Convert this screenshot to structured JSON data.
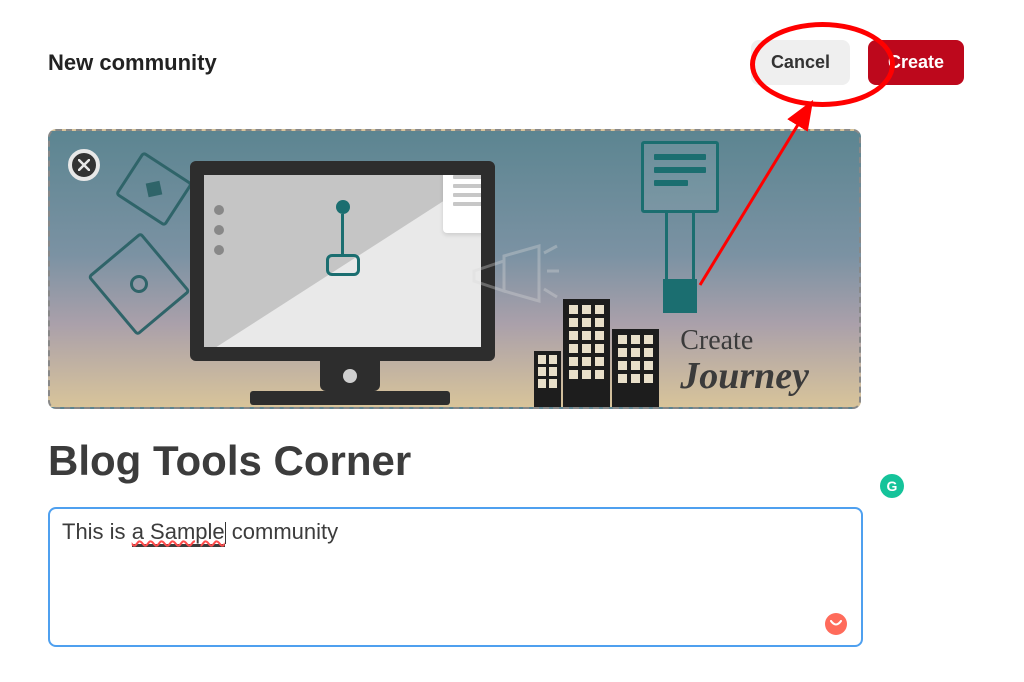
{
  "page_title": "New community",
  "buttons": {
    "cancel": "Cancel",
    "create": "Create"
  },
  "banner": {
    "text_line1": "Create",
    "text_line2": "Journey"
  },
  "community_name": "Blog Tools Corner",
  "description": {
    "prefix": "This is ",
    "spellchecked": "a Sample",
    "suffix": " community"
  },
  "grammarly_label": "G",
  "colors": {
    "primary": "#bd081c",
    "highlight": "#ff0000",
    "input_border": "#4fa0ef",
    "grammarly": "#15c39a",
    "warn_badge": "#ff6b5b"
  }
}
